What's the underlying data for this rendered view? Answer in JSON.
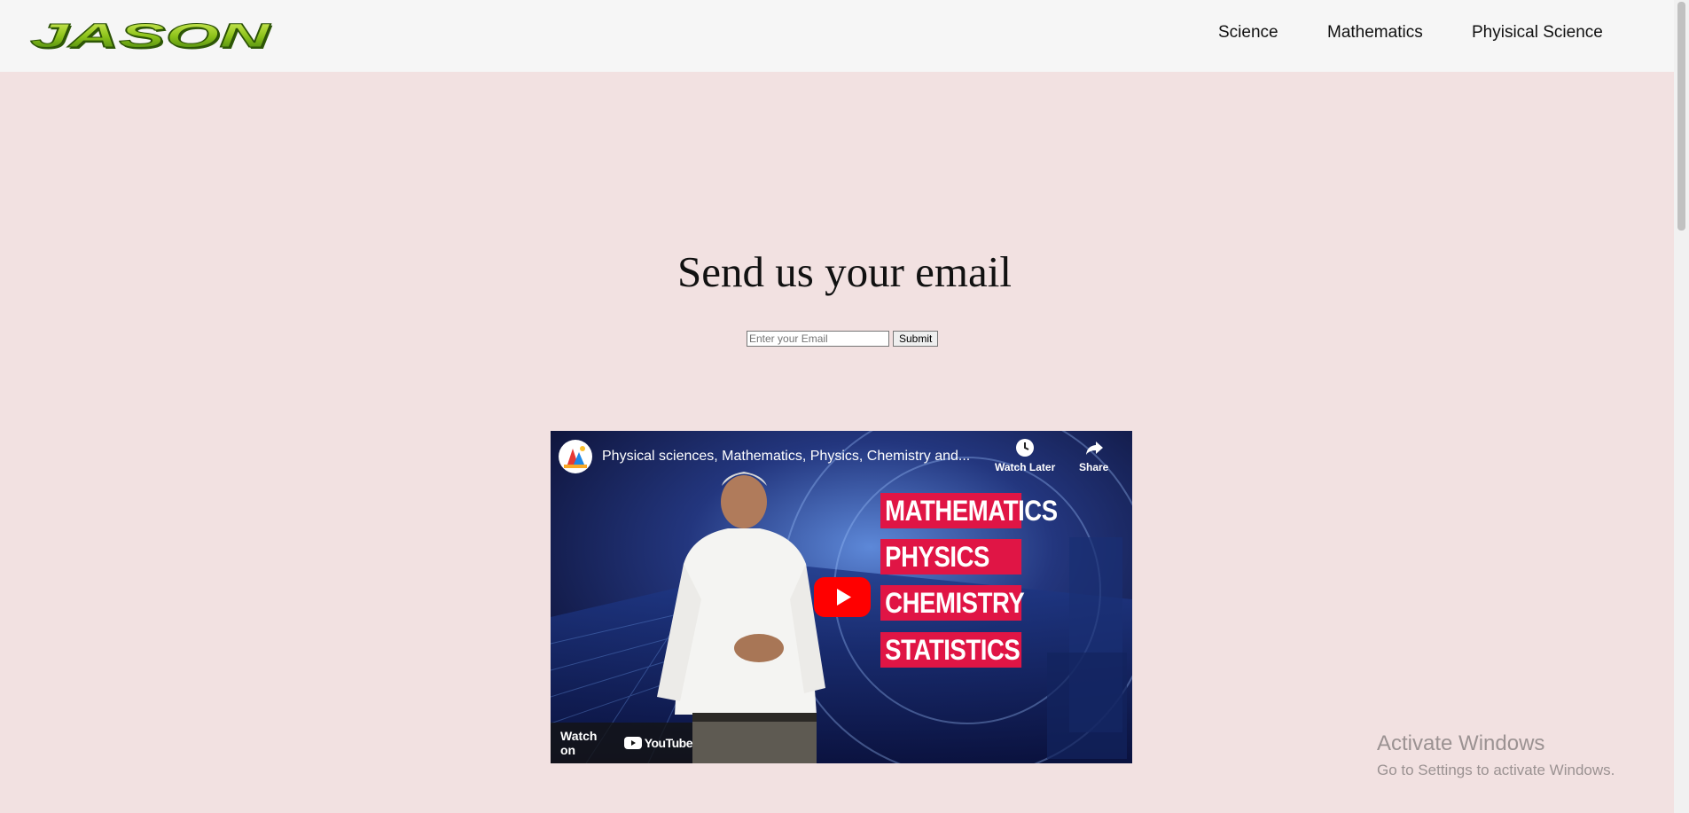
{
  "brand": {
    "logo_text": "JASON"
  },
  "nav": {
    "items": [
      {
        "label": "Science"
      },
      {
        "label": "Mathematics"
      },
      {
        "label": "Phyisical Science"
      }
    ]
  },
  "main": {
    "heading": "Send us your email",
    "email_placeholder": "Enter your Email",
    "submit_label": "Submit"
  },
  "video": {
    "title": "Physical sciences, Mathematics, Physics, Chemistry and...",
    "watch_later_label": "Watch Later",
    "share_label": "Share",
    "tags": [
      "MATHEMATICS",
      "PHYSICS",
      "CHEMISTRY",
      "STATISTICS"
    ],
    "watch_on_label": "Watch on",
    "youtube_label": "YouTube",
    "colors": {
      "tag_red": "#e01545",
      "play_red": "#ff0000"
    }
  },
  "os_overlay": {
    "title": "Activate Windows",
    "subtitle": "Go to Settings to activate Windows."
  }
}
